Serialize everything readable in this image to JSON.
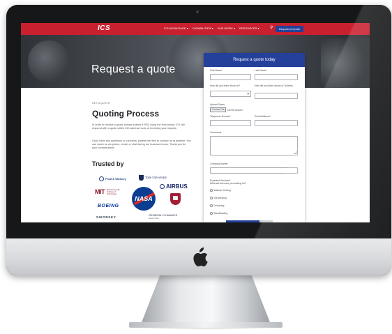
{
  "nav": {
    "brand": "ICS",
    "brand_tagline": "",
    "links": [
      "ICS ADVANTAGE",
      "CAPABILITIES",
      "OUR WORK",
      "RESOURCES"
    ],
    "search_icon": "search-icon",
    "cta": "Request A Quote"
  },
  "hero": {
    "title": "Request a quote"
  },
  "intro": {
    "eyebrow": "GET A QUOTE",
    "title": "Quoting Process",
    "paragraph1": "In order to receive a quote, please submit a RFQ using the form below. ICS will respond with a quote within 24 business hours of receiving your request.",
    "paragraph2": "If you have any questions or concerns, please feel free to contact us at anytime. You can reach us via phone, email, or chat during our business hours. Thank you for your consideration!",
    "trusted_title": "Trusted by"
  },
  "logos": {
    "pratt_whitney": "Pratt & Whitney",
    "yale": "Yale University",
    "airbus": "AIRBUS",
    "mit_mark": "MIT",
    "mit_text": "Massachusetts Institute of Technology",
    "nasa": "NASA",
    "harvard": "Harvard",
    "boeing": "BOEING",
    "sikorsky": "SIKORSKY",
    "general_dynamics": "GENERAL DYNAMICS",
    "general_dynamics_sub": "Electric Boat"
  },
  "form": {
    "title": "Request a quote today",
    "first_name_label": "First Name*",
    "last_name_label": "Last Name*",
    "heard_label": "How did you learn about us?",
    "heard_other_label": "How did you learn about us? (Other)",
    "upload_label": "Upload Specs",
    "choose_file": "Choose File",
    "no_file": "No file chosen",
    "phone_label": "Telephone Number*",
    "email_label": "Email Address*",
    "comments_label": "Comments",
    "company_label": "Company Name*",
    "services_label": "Expected Services*",
    "services_hint": "What services are you looking for?",
    "services": [
      "Waterjet Cutting",
      "Die-bending",
      "Deburring",
      "Sandblasting"
    ]
  },
  "colors": {
    "nav_red": "#c8202f",
    "brand_blue": "#24409a"
  }
}
